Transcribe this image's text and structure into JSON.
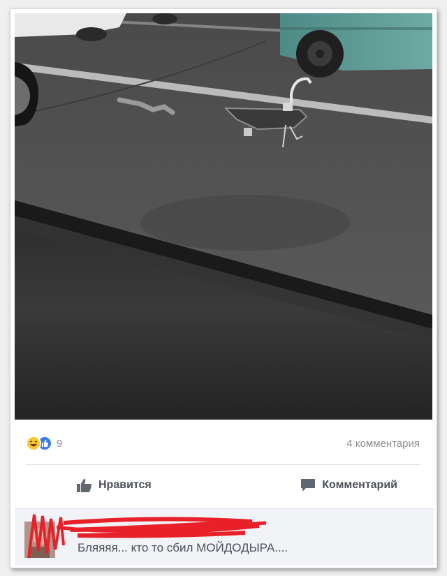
{
  "post": {
    "reactions": {
      "icons": [
        "haha-icon",
        "like-icon"
      ],
      "count": "9"
    },
    "comments_count": "4 комментария",
    "actions": {
      "like_label": "Нравится",
      "comment_label": "Комментарий"
    },
    "comment": {
      "text": "Бляяяя... кто то сбил МОЙДОДЫРА...."
    }
  },
  "colors": {
    "like_blue": "#3b7be8",
    "haha_yellow": "#f7c737",
    "scribble_red": "#e8202a"
  }
}
